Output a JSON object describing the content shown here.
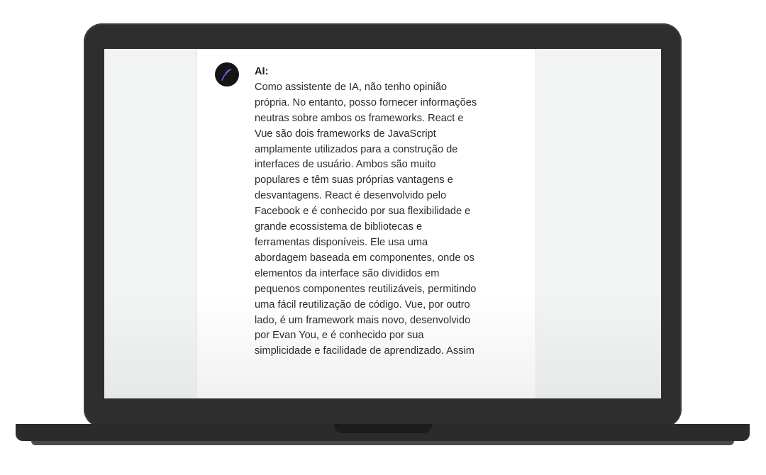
{
  "chat": {
    "sender": "AI:",
    "lines": [
      "Como assistente de IA, não tenho opinião",
      "própria. No entanto, posso fornecer informações",
      "neutras sobre ambos os frameworks. React e",
      "Vue são dois frameworks de JavaScript",
      "amplamente utilizados para a construção de",
      "interfaces de usuário. Ambos são muito",
      "populares e têm suas próprias vantagens e",
      "desvantagens. React é desenvolvido pelo",
      "Facebook e é conhecido por sua flexibilidade e",
      "grande ecossistema de bibliotecas e",
      "ferramentas disponíveis. Ele usa uma",
      "abordagem baseada em componentes, onde os",
      "elementos da interface são divididos em",
      "pequenos componentes reutilizáveis, permitindo",
      "uma fácil reutilização de código. Vue, por outro",
      "lado, é um framework mais novo, desenvolvido",
      "por Evan You, e é conhecido por sua",
      "simplicidade e facilidade de aprendizado. Assim"
    ],
    "avatar_icon": "quill-feather-icon",
    "accent_colors": [
      "#6c4cf5",
      "#8a6dfa"
    ]
  }
}
